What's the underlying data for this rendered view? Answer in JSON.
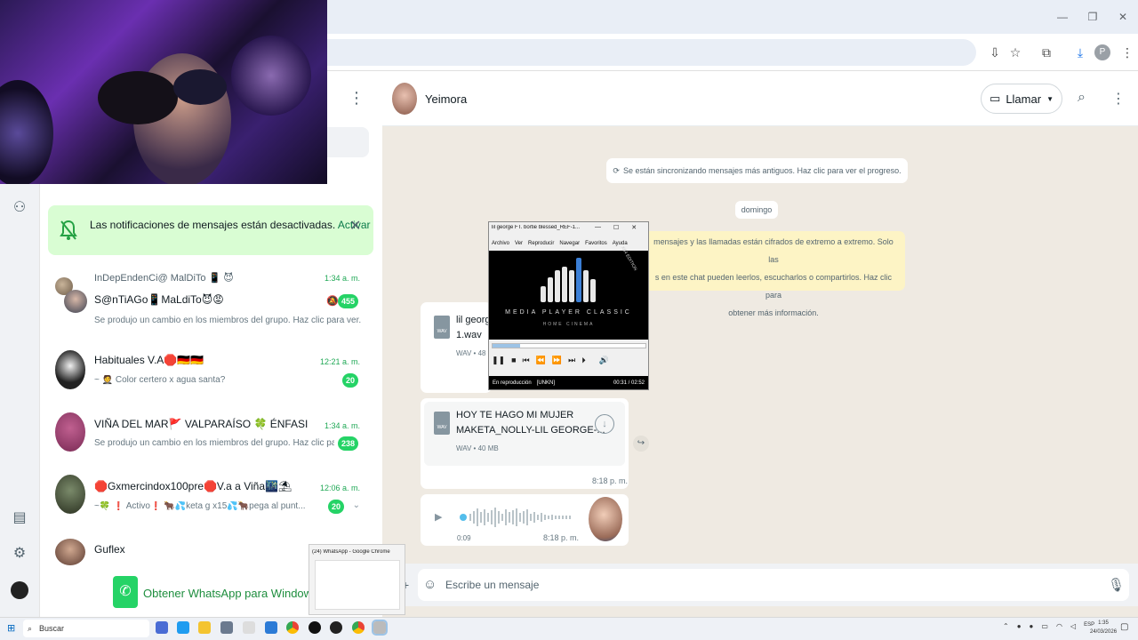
{
  "browser": {
    "window_controls": [
      "—",
      "❐",
      "✕"
    ],
    "profile_initial": "P"
  },
  "notification": {
    "text": "Las notificaciones de mensajes están desactivadas.",
    "action": "Activar"
  },
  "chats": [
    {
      "name_top": "InDepEndenCi@ MalDiTo 📱 😈",
      "name": "S@nTiAGo📱MaLdiTo😈😡",
      "time": "1:34 a. m.",
      "preview": "Se produjo un cambio en los miembros del grupo. Haz clic para ver...",
      "badge": "455",
      "muted": true
    },
    {
      "name": "Habituales V.A🛑🇩🇪🇩🇪",
      "time": "12:21 a. m.",
      "preview": "~ 🤵 Color certero x agua santa?",
      "badge": "20"
    },
    {
      "name": "VIÑA DEL MAR🚩 VALPARAÍSO 🍀 ÉNFASIS MIL...",
      "time": "1:34 a. m.",
      "preview": "Se produjo un cambio en los miembros del grupo. Haz clic pa...",
      "badge": "238"
    },
    {
      "name": "🛑Gxmercindox100pre🛑V.a a Viña🌃⛱",
      "time": "12:06 a. m.",
      "preview": "~🍀 ❗ Activo❗ 🐂💦keta g x15💦🐂pega al punt...",
      "badge": "20"
    },
    {
      "name": "Guflex",
      "time": "",
      "preview": "",
      "badge": ""
    }
  ],
  "get_whatsapp": "Obtener WhatsApp para Windows",
  "conversation": {
    "contact": "Yeimora",
    "call_label": "Llamar",
    "sync_text": "Se están sincronizando mensajes más antiguos. Haz clic para ver el progreso.",
    "day_chip": "domingo",
    "e2e_lines": [
      "mensajes y las llamadas están cifrados de extremo a extremo. Solo las",
      "s en este chat pueden leerlos, escucharlos o compartirlos. Haz clic para",
      "obtener más información."
    ],
    "file1": {
      "name_l1": "lil georg",
      "name_l2": "1.wav",
      "meta": "WAV • 48"
    },
    "file2": {
      "name_l1": "HOY TE HAGO MI MUJER",
      "name_l2": "MAKETA_NOLLY-LIL GEORGE-...",
      "meta": "WAV • 40 MB",
      "time": "8:18 p. m."
    },
    "voice": {
      "duration": "0:09",
      "time": "8:18 p. m."
    },
    "composer_placeholder": "Escribe un mensaje"
  },
  "media_player": {
    "title": "lil george FT. bortie blessed_REF-1...",
    "menu": [
      "Archivo",
      "Ver",
      "Reproducir",
      "Navegar",
      "Favoritos",
      "Ayuda"
    ],
    "logo": "MEDIA PLAYER CLASSIC",
    "subtitle": "HOME CINEMA",
    "edition": "X64 EDITION",
    "status": "En reproducción",
    "status_tag": "[UNKN]",
    "time": "00:31 / 02:52",
    "seek_fraction": 0.18
  },
  "taskbar_preview": {
    "title": "(24) WhatsApp - Google Chrome"
  },
  "taskbar": {
    "search_placeholder": "Buscar",
    "lang": "ESP",
    "clock_time": "1:35",
    "clock_date": "24/03/2026"
  }
}
